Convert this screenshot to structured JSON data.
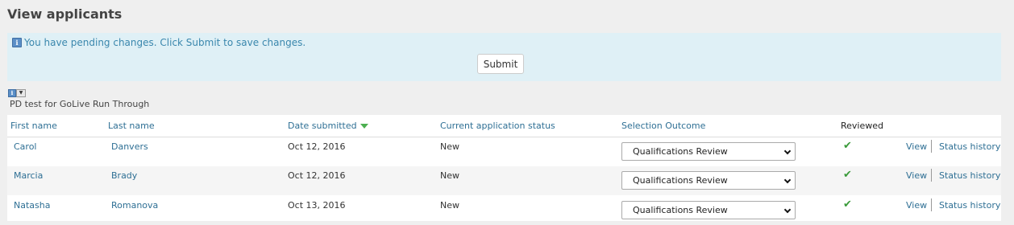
{
  "page_title": "View applicants",
  "notice": {
    "icon": "info-icon",
    "message": "You have pending changes. Click Submit to save changes.",
    "submit_label": "Submit"
  },
  "subtitle": "PD test for GoLive Run Through",
  "table": {
    "headers": {
      "first_name": "First name",
      "last_name": "Last name",
      "date_submitted": "Date submitted",
      "status": "Current application status",
      "outcome": "Selection Outcome",
      "reviewed": "Reviewed"
    },
    "sort_indicator": "sort-descending-icon",
    "rows": [
      {
        "first": "Carol",
        "last": "Danvers",
        "date": "Oct 12, 2016",
        "status": "New",
        "outcome": "Qualifications Review",
        "reviewed": "✔",
        "view": "View",
        "history": "Status history"
      },
      {
        "first": "Marcia",
        "last": "Brady",
        "date": "Oct 12, 2016",
        "status": "New",
        "outcome": "Qualifications Review",
        "reviewed": "✔",
        "view": "View",
        "history": "Status history"
      },
      {
        "first": "Natasha",
        "last": "Romanova",
        "date": "Oct 13, 2016",
        "status": "New",
        "outcome": "Qualifications Review",
        "reviewed": "✔",
        "view": "View",
        "history": "Status history"
      }
    ]
  },
  "colors": {
    "link": "#2e6f94",
    "notice_bg": "#dff0f6",
    "notice_text": "#3a87ad",
    "check": "#3a9a3a"
  }
}
